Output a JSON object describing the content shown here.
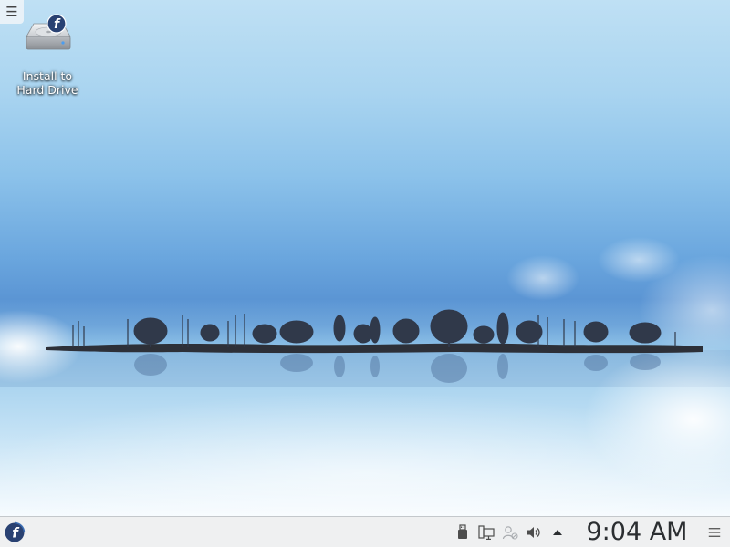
{
  "desktop": {
    "toolbox_icon": "hamburger-menu-icon",
    "icons": [
      {
        "label_line1": "Install to",
        "label_line2": "Hard Drive",
        "icon": "hard-drive-fedora-icon"
      }
    ]
  },
  "panel": {
    "launcher_icon": "fedora-logo-icon",
    "tray": [
      "usb-device-icon",
      "network-icon",
      "user-status-icon",
      "volume-icon",
      "expand-tray-icon"
    ],
    "clock": {
      "time": "9:04 AM"
    },
    "options_icon": "hamburger-menu-icon"
  },
  "colors": {
    "panel_bg": "#eff0f1",
    "fedora_blue": "#294172",
    "sky_top": "#bfe0f4",
    "horizon_blue": "#5b95d4"
  }
}
